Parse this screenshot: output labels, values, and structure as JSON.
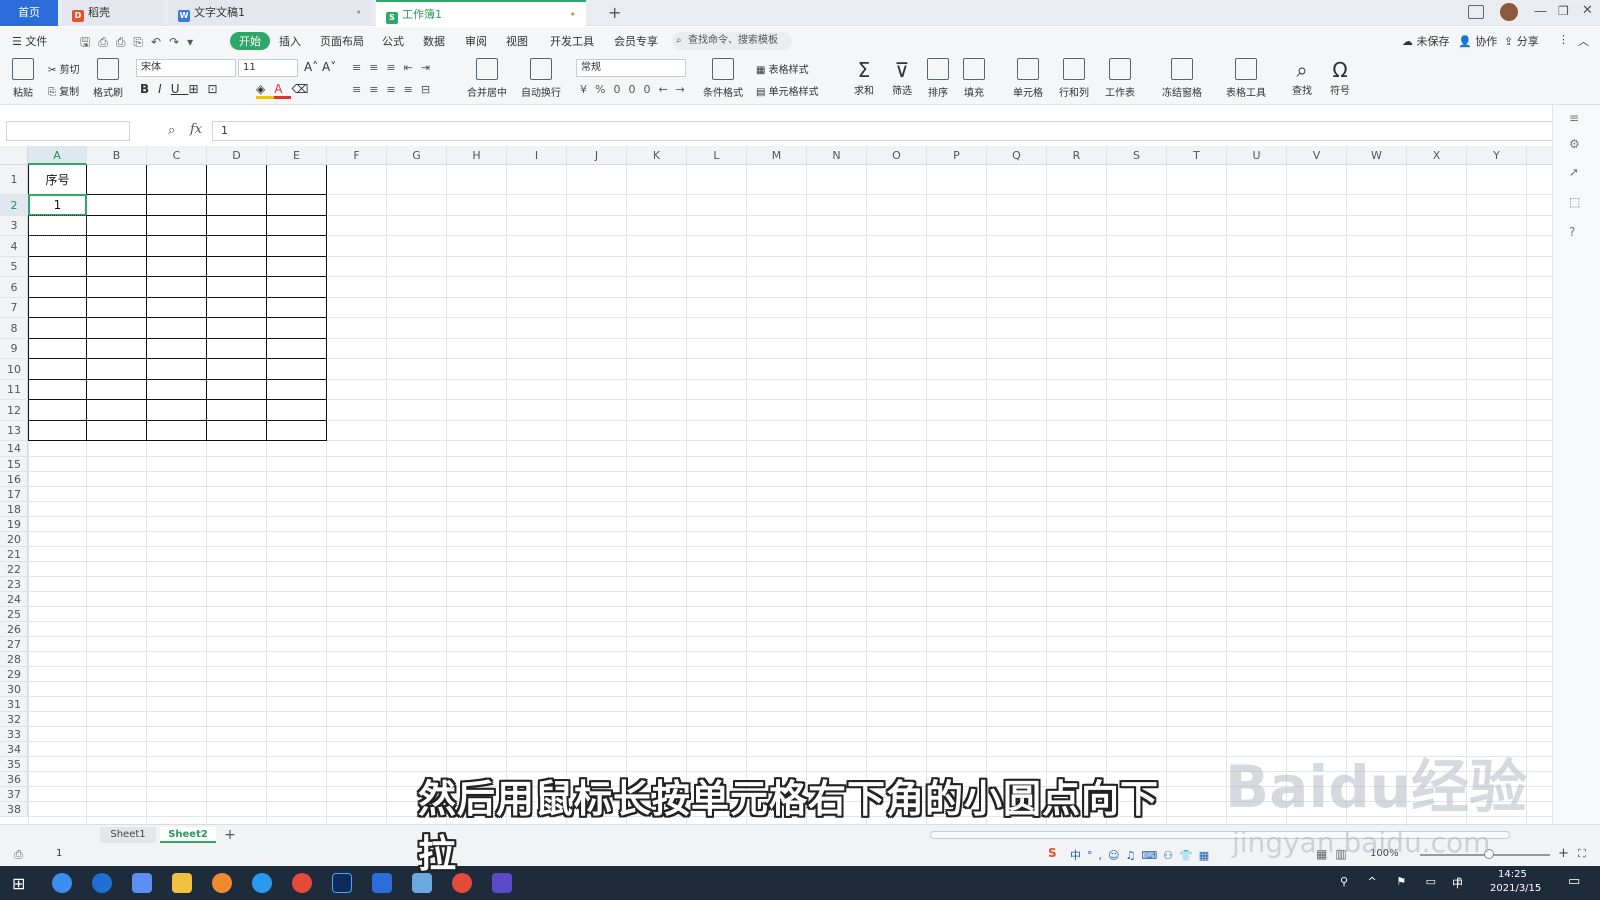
{
  "tabs": {
    "home": "首页",
    "daoke": "稻壳",
    "doc": "文字文稿1",
    "book": "工作簿1",
    "add": "+"
  },
  "menu": {
    "file": "文件",
    "items": [
      "开始",
      "插入",
      "页面布局",
      "公式",
      "数据",
      "审阅",
      "视图",
      "开发工具",
      "会员专享"
    ],
    "search_placeholder": "查找命令、搜索模板",
    "unsaved": "未保存",
    "collab": "协作",
    "share": "分享"
  },
  "ribbon": {
    "paste": "粘贴",
    "cut": "剪切",
    "copy": "复制",
    "format_painter": "格式刷",
    "font_name": "宋体",
    "font_size": "11",
    "merge_center": "合并居中",
    "wrap_text": "自动换行",
    "number_format": "常规",
    "conditional_format": "条件格式",
    "table_style": "表格样式",
    "cell_style": "单元格样式",
    "sum": "求和",
    "filter": "筛选",
    "sort": "排序",
    "fill": "填充",
    "cell": "单元格",
    "row_col": "行和列",
    "worksheet": "工作表",
    "freeze": "冻结窗格",
    "table_tools": "表格工具",
    "find": "查找",
    "symbol": "符号"
  },
  "formula_bar": {
    "value": "1"
  },
  "columns": [
    "A",
    "B",
    "C",
    "D",
    "E",
    "F",
    "G",
    "H",
    "I",
    "J",
    "K",
    "L",
    "M",
    "N",
    "O",
    "P",
    "Q",
    "R",
    "S",
    "T",
    "U",
    "V",
    "W",
    "X",
    "Y"
  ],
  "rows": [
    "1",
    "2",
    "3",
    "4",
    "5",
    "6",
    "7",
    "8",
    "9",
    "10",
    "11",
    "12",
    "13",
    "14",
    "15",
    "16",
    "17",
    "18",
    "19",
    "20",
    "21",
    "22",
    "23",
    "24",
    "25",
    "26",
    "27",
    "28",
    "29",
    "30",
    "31",
    "32",
    "33",
    "34",
    "35",
    "36",
    "37",
    "38"
  ],
  "cells": {
    "A1": "序号",
    "A2": "1"
  },
  "sheets": [
    "Sheet1",
    "Sheet2"
  ],
  "active_sheet": "Sheet2",
  "status": {
    "value": "1",
    "zoom": "100%"
  },
  "taskbar": {
    "time": "14:25",
    "date": "2021/3/15",
    "ime": "中"
  },
  "overlay": {
    "subtitle": "然后用鼠标长按单元格右下角的小圆点向下拉",
    "watermark": "Baidu经验",
    "watermark_url": "jingyan.baidu.com"
  }
}
